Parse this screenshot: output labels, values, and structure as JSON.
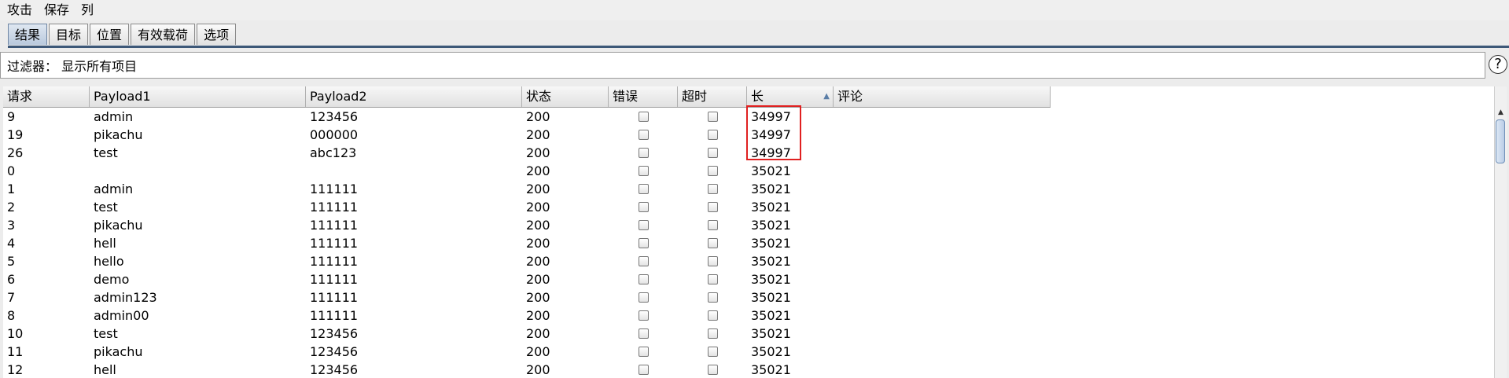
{
  "menu": {
    "items": [
      "攻击",
      "保存",
      "列"
    ]
  },
  "tabs": [
    "结果",
    "目标",
    "位置",
    "有效载荷",
    "选项"
  ],
  "filter": {
    "label": "过滤器： 显示所有项目",
    "help": "?"
  },
  "table": {
    "columns": [
      "请求",
      "Payload1",
      "Payload2",
      "状态",
      "错误",
      "超时",
      "长",
      "评论"
    ],
    "sorted_column": "长",
    "sort_direction": "ascending",
    "rows": [
      [
        "9",
        "admin",
        "123456",
        "200",
        "34997"
      ],
      [
        "19",
        "pikachu",
        "000000",
        "200",
        "34997"
      ],
      [
        "26",
        "test",
        "abc123",
        "200",
        "34997"
      ],
      [
        "0",
        "",
        "",
        "200",
        "35021"
      ],
      [
        "1",
        "admin",
        "111111",
        "200",
        "35021"
      ],
      [
        "2",
        "test",
        "111111",
        "200",
        "35021"
      ],
      [
        "3",
        "pikachu",
        "111111",
        "200",
        "35021"
      ],
      [
        "4",
        "hell",
        "111111",
        "200",
        "35021"
      ],
      [
        "5",
        "hello",
        "111111",
        "200",
        "35021"
      ],
      [
        "6",
        "demo",
        "111111",
        "200",
        "35021"
      ],
      [
        "7",
        "admin123",
        "111111",
        "200",
        "35021"
      ],
      [
        "8",
        "admin00",
        "111111",
        "200",
        "35021"
      ],
      [
        "10",
        "test",
        "123456",
        "200",
        "35021"
      ],
      [
        "11",
        "pikachu",
        "123456",
        "200",
        "35021"
      ],
      [
        "12",
        "hell",
        "123456",
        "200",
        "35021"
      ]
    ]
  },
  "colors": {
    "accent": "#3d5878",
    "highlight": "#e02020",
    "background": "#ececec"
  }
}
